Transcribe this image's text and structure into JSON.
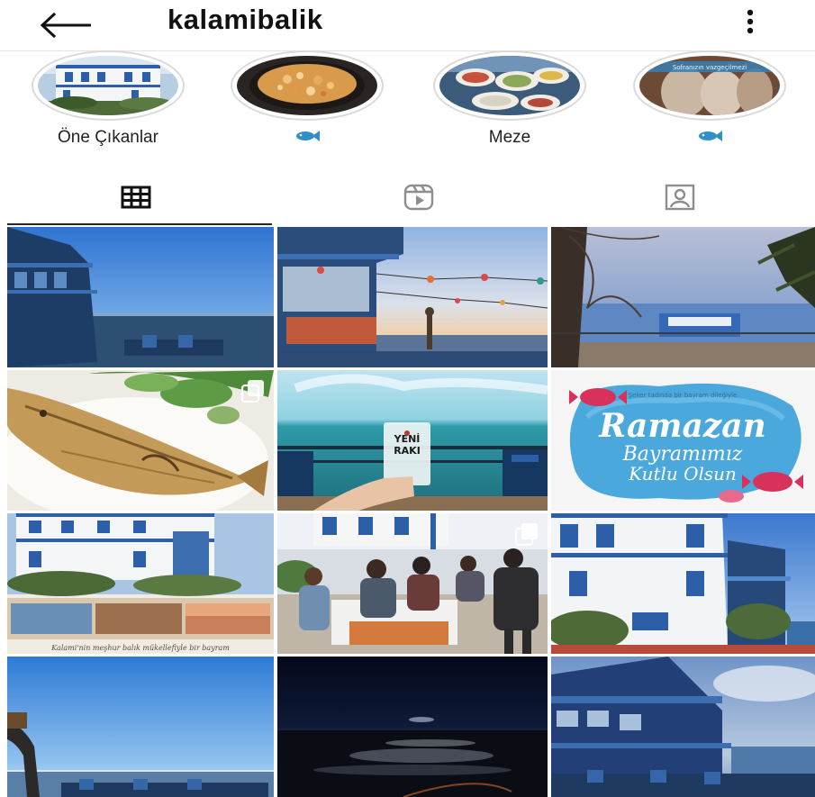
{
  "header": {
    "username": "kalamibalik",
    "back_icon": "arrow-left-icon",
    "more_icon": "more-vertical-icon"
  },
  "highlights": [
    {
      "label": "Öne Çıkanlar",
      "cover": "restaurant building"
    },
    {
      "label": "",
      "label_icon": "fish-emoji",
      "cover": "shrimp casserole"
    },
    {
      "label": "Meze",
      "cover": "meze plates"
    },
    {
      "label": "",
      "label_icon": "fish-emoji",
      "cover": "fish with caption",
      "cover_text": "Sofranızın vazgeçilmezi"
    }
  ],
  "tabs": [
    {
      "name": "posts",
      "icon": "grid-icon",
      "active": true
    },
    {
      "name": "reels",
      "icon": "reels-icon",
      "active": false
    },
    {
      "name": "tagged",
      "icon": "tagged-user-icon",
      "active": false
    }
  ],
  "posts": [
    {
      "alt": "blue restaurant terrace over the sea"
    },
    {
      "alt": "terrace with string lights at sunset"
    },
    {
      "alt": "table by the sea with fishing net"
    },
    {
      "alt": "grilled fish with salad",
      "multi": true
    },
    {
      "alt": "glass of Yeni Rakı by the sea",
      "glass_text_1": "YENİ",
      "glass_text_2": "RAKI"
    },
    {
      "alt": "Ramazan Bayramı greeting",
      "small_text": "Şeker tadında bir bayram dileğiyle",
      "line1": "Ramazan",
      "line2": "Bayramımız",
      "line3": "Kutlu Olsun"
    },
    {
      "alt": "Kalami collage",
      "caption": "Kalami'nin meşhur balık mükellefiyle bir bayram"
    },
    {
      "alt": "people preparing meze at tables",
      "multi": true
    },
    {
      "alt": "white and blue Kalami building"
    },
    {
      "alt": "sea view with driftwood"
    },
    {
      "alt": "sea at night with moon reflection"
    },
    {
      "alt": "blue restaurant building by the sea"
    }
  ],
  "colors": {
    "accent_blue": "#2d5fa8",
    "sky": "#4f8ed6",
    "sea": "#2b5f8c",
    "text": "#111111",
    "divider": "#e4e4e4"
  }
}
